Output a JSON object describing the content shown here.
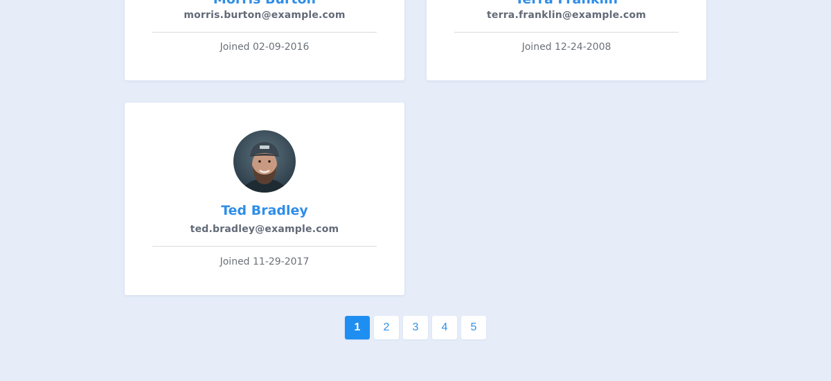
{
  "colors": {
    "background": "#e6edf9",
    "card": "#ffffff",
    "name": "#2f8ee8",
    "email": "#626a77",
    "joined": "#6a7079",
    "active_page": "#1f8ef1"
  },
  "users": [
    {
      "name": "Morris Burton",
      "email": "morris.burton@example.com",
      "joined": "Joined 02-09-2016"
    },
    {
      "name": "Terra Franklin",
      "email": "terra.franklin@example.com",
      "joined": "Joined 12-24-2008"
    },
    {
      "name": "Ted Bradley",
      "email": "ted.bradley@example.com",
      "joined": "Joined 11-29-2017",
      "avatar": "user-photo-avatar"
    }
  ],
  "pagination": {
    "pages": [
      "1",
      "2",
      "3",
      "4",
      "5"
    ],
    "current": "1"
  }
}
